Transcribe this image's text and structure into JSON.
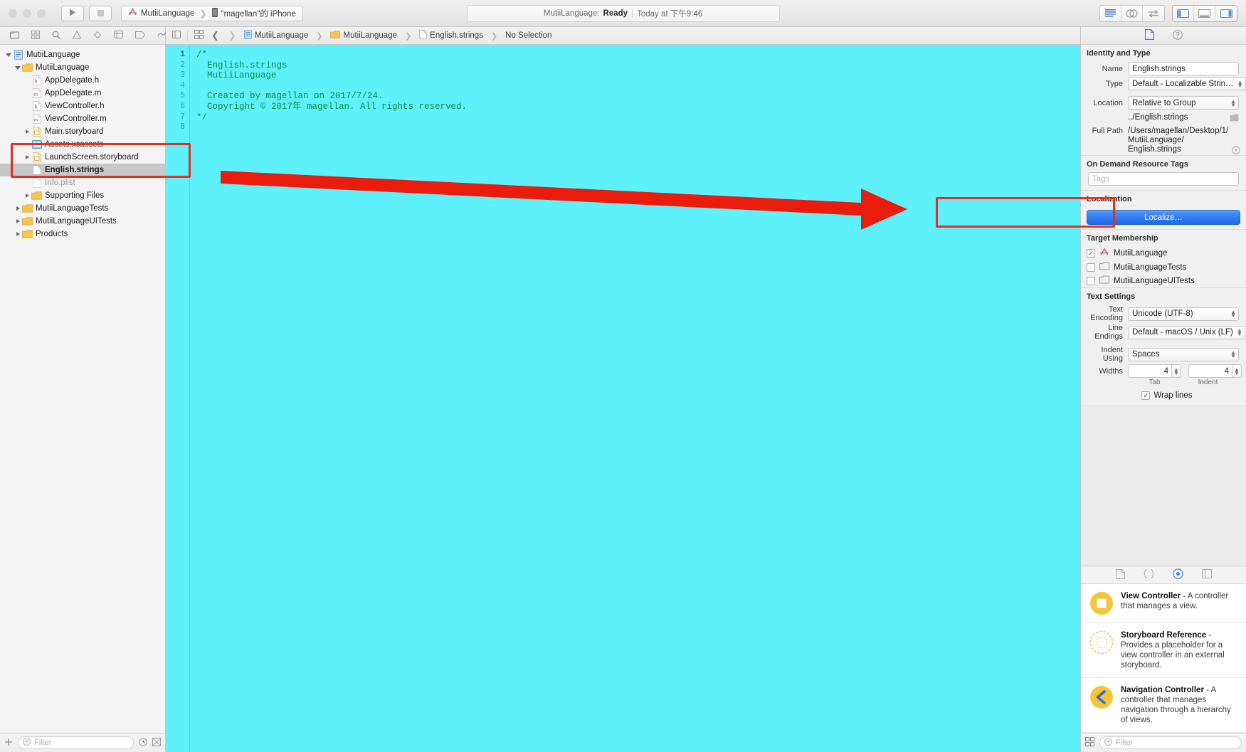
{
  "toolbar": {
    "run_label": "run-triangle",
    "stop_label": "stop-square",
    "scheme_project": "MutiiLanguage",
    "scheme_device": "\"magellan\"的 iPhone",
    "status_prefix": "MutiiLanguage:",
    "status_state": "Ready",
    "status_divider": "|",
    "status_time": "Today at 下午9:46"
  },
  "navigator": {
    "filter_placeholder": "Filter",
    "items": [
      {
        "label": "MutiiLanguage",
        "indent": 0,
        "twisty": "open",
        "icon": "project-icon",
        "selected": false,
        "dim": false
      },
      {
        "label": "MutiiLanguage",
        "indent": 1,
        "twisty": "open",
        "icon": "folder-icon",
        "selected": false,
        "dim": false
      },
      {
        "label": "AppDelegate.h",
        "indent": 2,
        "twisty": "none",
        "icon": "header-icon",
        "selected": false,
        "dim": false
      },
      {
        "label": "AppDelegate.m",
        "indent": 2,
        "twisty": "none",
        "icon": "source-icon",
        "selected": false,
        "dim": false
      },
      {
        "label": "ViewController.h",
        "indent": 2,
        "twisty": "none",
        "icon": "header-icon",
        "selected": false,
        "dim": false
      },
      {
        "label": "ViewController.m",
        "indent": 2,
        "twisty": "none",
        "icon": "source-icon",
        "selected": false,
        "dim": false
      },
      {
        "label": "Main.storyboard",
        "indent": 2,
        "twisty": "closed",
        "icon": "storyboard-icon",
        "selected": false,
        "dim": false
      },
      {
        "label": "Assets.xcassets",
        "indent": 2,
        "twisty": "none",
        "icon": "assets-icon",
        "selected": false,
        "dim": false
      },
      {
        "label": "LaunchScreen.storyboard",
        "indent": 2,
        "twisty": "closed",
        "icon": "storyboard-icon",
        "selected": false,
        "dim": false
      },
      {
        "label": "English.strings",
        "indent": 2,
        "twisty": "none",
        "icon": "strings-icon",
        "selected": true,
        "dim": false
      },
      {
        "label": "Info.plist",
        "indent": 2,
        "twisty": "none",
        "icon": "plist-icon",
        "selected": false,
        "dim": true
      },
      {
        "label": "Supporting Files",
        "indent": 2,
        "twisty": "closed",
        "icon": "folder-icon",
        "selected": false,
        "dim": false
      },
      {
        "label": "MutiiLanguageTests",
        "indent": 1,
        "twisty": "closed",
        "icon": "folder-icon",
        "selected": false,
        "dim": false
      },
      {
        "label": "MutiiLanguageUITests",
        "indent": 1,
        "twisty": "closed",
        "icon": "folder-icon",
        "selected": false,
        "dim": false
      },
      {
        "label": "Products",
        "indent": 1,
        "twisty": "closed",
        "icon": "folder-icon",
        "selected": false,
        "dim": false
      }
    ]
  },
  "jumpbar": {
    "crumbs": [
      {
        "label": "MutiiLanguage",
        "icon": "project-icon"
      },
      {
        "label": "MutiiLanguage",
        "icon": "folder-icon"
      },
      {
        "label": "English.strings",
        "icon": "strings-icon"
      },
      {
        "label": "No Selection",
        "icon": "none"
      }
    ]
  },
  "editor": {
    "line_numbers": [
      "1",
      "2",
      "3",
      "4",
      "5",
      "6",
      "7",
      "8"
    ],
    "lines": [
      "/*",
      "  English.strings",
      "  MutiiLanguage",
      "",
      "  Created by magellan on 2017/7/24.",
      "  Copyright © 2017年 magellan. All rights reserved.",
      "*/",
      ""
    ]
  },
  "inspector": {
    "identity": {
      "heading": "Identity and Type",
      "name_label": "Name",
      "name_value": "English.strings",
      "type_label": "Type",
      "type_value": "Default - Localizable Strin…",
      "location_label": "Location",
      "location_value": "Relative to Group",
      "relative_path": "../English.strings",
      "fullpath_label": "Full Path",
      "fullpath_value": "/Users/magellan/Desktop/1/MutiiLanguage/English.strings"
    },
    "odr": {
      "heading": "On Demand Resource Tags",
      "tags_placeholder": "Tags"
    },
    "localization": {
      "heading": "Localization",
      "button_label": "Localize…"
    },
    "target_membership": {
      "heading": "Target Membership",
      "rows": [
        {
          "label": "MutiiLanguage",
          "checked": true,
          "icon": "app-target-icon"
        },
        {
          "label": "MutiiLanguageTests",
          "checked": false,
          "icon": "test-target-icon"
        },
        {
          "label": "MutiiLanguageUITests",
          "checked": false,
          "icon": "test-target-icon"
        }
      ]
    },
    "text_settings": {
      "heading": "Text Settings",
      "encoding_label": "Text Encoding",
      "encoding_value": "Unicode (UTF-8)",
      "line_endings_label": "Line Endings",
      "line_endings_value": "Default - macOS / Unix (LF)",
      "indent_using_label": "Indent Using",
      "indent_using_value": "Spaces",
      "widths_label": "Widths",
      "tab_width": "4",
      "indent_width": "4",
      "tab_sublabel": "Tab",
      "indent_sublabel": "Indent",
      "wrap_lines_label": "Wrap lines",
      "wrap_lines_checked": true
    }
  },
  "library": {
    "filter_placeholder": "Filter",
    "items": [
      {
        "title": "View Controller",
        "dash": " - ",
        "desc": "A controller that manages a view.",
        "icon": "view-controller-icon"
      },
      {
        "title": "Storyboard Reference",
        "dash": " - ",
        "desc": "Provides a placeholder for a view controller in an external storyboard.",
        "icon": "storyboard-reference-icon"
      },
      {
        "title": "Navigation Controller",
        "dash": " - ",
        "desc": "A controller that manages navigation through a hierarchy of views.",
        "icon": "navigation-controller-icon"
      }
    ]
  },
  "annotations": {
    "highlight_color": "#e82e20",
    "arrow_color": "#ea1c0d"
  }
}
